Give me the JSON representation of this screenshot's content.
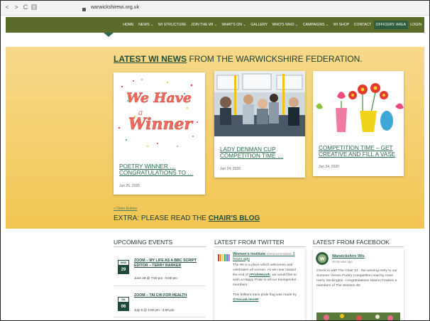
{
  "browser": {
    "back": "<",
    "forward": ">",
    "reload": "C",
    "url": "warwickshirewi.org.uk"
  },
  "nav": {
    "items": [
      "HOME",
      "NEWS ⌄",
      "WI STRUCTURE",
      "JOIN THE WI ⌄",
      "WHAT'S ON ⌄",
      "GALLERY",
      "WHO'S WHO ⌄",
      "CAMPAIGNS ⌄",
      "WI SHOP",
      "CONTACT",
      "OFFICERS' AREA",
      "LOGIN"
    ]
  },
  "hero": {
    "title_em": "LATEST WI NEWS",
    "title_rest": "FROM THE WARWICKSHIRE FEDERATION.",
    "poster_text_1": "We Have",
    "poster_text_2": "a",
    "poster_text_3": "Winner",
    "cards": [
      {
        "title": "POETRY WINNER … CONGRATULATIONS TO …",
        "date": "Jun 25, 2020",
        "image": "poetry-winner-image"
      },
      {
        "title": "LADY DENMAN CUP COMPETITION TIME …",
        "date": "Jun 24, 2020",
        "image": "bus-passengers-image"
      },
      {
        "title": "COMPETITION TIME – GET CREATIVE AND FILL A VASE",
        "date": "Jun 24, 2020",
        "image": "flowers-in-vases-image"
      }
    ],
    "older_entries": "« Older Entries",
    "extra_text": "EXTRA: PLEASE READ THE",
    "extra_link": "CHAIR'S BLOG"
  },
  "events": {
    "heading": "UPCOMING EVENTS",
    "items": [
      {
        "month": "MON",
        "day": "29",
        "title": "ZOOM – MY LIFE AS A BBC SCRIPT EDITOR – TERRY BARKER",
        "time": "June 29 @ 7:00 pm - 8:00 pm"
      },
      {
        "month": "JUL",
        "day": "06",
        "title": "ZOOM – TAI CHI FOR HEALTH",
        "time": "July 6 @ 2:00 pm - 3:00 pm"
      }
    ]
  },
  "twitter": {
    "heading": "LATEST FROM TWITTER",
    "name": "Women's Institute",
    "handle": "@WomensInstitute",
    "age": "3 hours ago",
    "text_1": "The WI is a place which welcomes and celebrates all women. As we near toward the end of",
    "hashtag": "#PrideMonth",
    "text_2": ", we would like to wish a Happy Pride to all our transgender members.",
    "text_3": "This brilliant trans pride flag was made by",
    "mention": "@SocialLitesWI"
  },
  "facebook": {
    "heading": "LATEST FROM FACEBOOK",
    "name": "Warwickshire WIs",
    "age": "48 minutes ago",
    "text": "Check in with The Chair 14 - the winning entry to our Summer Verses Poetry Competition read by Anne Harry Seckington. Congratulations Marion Fewkes a members of The Wolston WI"
  },
  "colors": {
    "nav_bg": "#5b6b2a",
    "brand_green": "#214f39",
    "hero_yellow": "#f2c653"
  }
}
